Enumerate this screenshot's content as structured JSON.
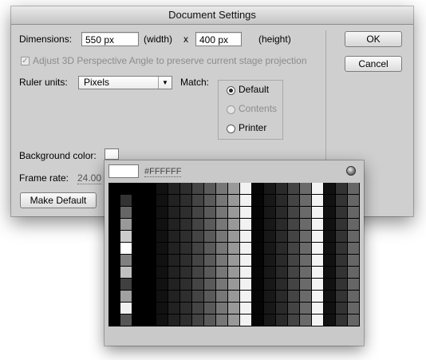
{
  "dialog": {
    "title": "Document Settings",
    "dimensions": {
      "label": "Dimensions:",
      "width_value": "550 px",
      "width_label": "(width)",
      "times": "x",
      "height_value": "400 px",
      "height_label": "(height)"
    },
    "adjust_3d": {
      "label": "Adjust 3D Perspective Angle to preserve current stage projection",
      "checked": true,
      "check_glyph": "✓"
    },
    "ruler_units": {
      "label": "Ruler units:",
      "value": "Pixels",
      "arrow": "▼"
    },
    "match": {
      "label": "Match:",
      "options": [
        "Default",
        "Contents",
        "Printer"
      ],
      "selected": "Default"
    },
    "background_color": {
      "label": "Background color:",
      "value": "#FFFFFF"
    },
    "frame_rate": {
      "label": "Frame rate:",
      "value": "24.00"
    },
    "make_default_label": "Make Default",
    "ok_label": "OK",
    "cancel_label": "Cancel"
  },
  "palette": {
    "hex": "#FFFFFF",
    "no_color_icon": "no-color-icon",
    "first_col": [
      "#000000",
      "#333333",
      "#666666",
      "#999999",
      "#cccccc",
      "#ffffff",
      "#808080",
      "#c0c0c0",
      "#404040",
      "#a0a0a0",
      "#f0f0f0",
      "#555555"
    ],
    "rows": [
      [
        "#000000",
        "#000000",
        "#000000",
        "#000000",
        "#000000",
        "#000000",
        "#000000",
        "#000000",
        "#000000",
        "#000000",
        "#000000",
        "#000000"
      ],
      [
        "#000000",
        "#000000",
        "#000000",
        "#000000",
        "#000000",
        "#000000",
        "#000000",
        "#000000",
        "#000000",
        "#000000",
        "#000000",
        "#000000"
      ],
      [
        "#000000",
        "#000000",
        "#000000",
        "#000000",
        "#000000",
        "#000000",
        "#000000",
        "#000000",
        "#000000",
        "#000000",
        "#000000",
        "#000000"
      ],
      [
        "#111111",
        "#111111",
        "#111111",
        "#111111",
        "#111111",
        "#111111",
        "#111111",
        "#111111",
        "#111111",
        "#111111",
        "#111111",
        "#111111"
      ],
      [
        "#222222",
        "#222222",
        "#222222",
        "#222222",
        "#222222",
        "#222222",
        "#222222",
        "#222222",
        "#222222",
        "#222222",
        "#222222",
        "#222222"
      ],
      [
        "#2e2e2e",
        "#2e2e2e",
        "#2e2e2e",
        "#2e2e2e",
        "#2e2e2e",
        "#2e2e2e",
        "#2e2e2e",
        "#2e2e2e",
        "#2e2e2e",
        "#2e2e2e",
        "#2e2e2e",
        "#2e2e2e"
      ],
      [
        "#444444",
        "#444444",
        "#444444",
        "#444444",
        "#444444",
        "#444444",
        "#444444",
        "#444444",
        "#444444",
        "#444444",
        "#444444",
        "#444444"
      ],
      [
        "#5a5a5a",
        "#5a5a5a",
        "#5a5a5a",
        "#5a5a5a",
        "#5a5a5a",
        "#5a5a5a",
        "#5a5a5a",
        "#5a5a5a",
        "#5a5a5a",
        "#5a5a5a",
        "#5a5a5a",
        "#5a5a5a"
      ],
      [
        "#777777",
        "#777777",
        "#777777",
        "#777777",
        "#777777",
        "#777777",
        "#777777",
        "#777777",
        "#777777",
        "#777777",
        "#777777",
        "#777777"
      ],
      [
        "#999999",
        "#999999",
        "#999999",
        "#999999",
        "#999999",
        "#999999",
        "#999999",
        "#999999",
        "#999999",
        "#999999",
        "#999999",
        "#999999"
      ],
      [
        "#f2f2f2",
        "#f2f2f2",
        "#f2f2f2",
        "#f2f2f2",
        "#f2f2f2",
        "#f2f2f2",
        "#f2f2f2",
        "#f2f2f2",
        "#f2f2f2",
        "#f2f2f2",
        "#f2f2f2",
        "#f2f2f2"
      ],
      [
        "#050505",
        "#050505",
        "#050505",
        "#050505",
        "#050505",
        "#050505",
        "#050505",
        "#050505",
        "#050505",
        "#050505",
        "#050505",
        "#050505"
      ],
      [
        "#181818",
        "#181818",
        "#181818",
        "#181818",
        "#181818",
        "#181818",
        "#181818",
        "#181818",
        "#181818",
        "#181818",
        "#181818",
        "#181818"
      ],
      [
        "#2a2a2a",
        "#2a2a2a",
        "#2a2a2a",
        "#2a2a2a",
        "#2a2a2a",
        "#2a2a2a",
        "#2a2a2a",
        "#2a2a2a",
        "#2a2a2a",
        "#2a2a2a",
        "#2a2a2a",
        "#2a2a2a"
      ],
      [
        "#444444",
        "#444444",
        "#444444",
        "#444444",
        "#444444",
        "#444444",
        "#444444",
        "#444444",
        "#444444",
        "#444444",
        "#444444",
        "#444444"
      ],
      [
        "#6a6a6a",
        "#6a6a6a",
        "#6a6a6a",
        "#6a6a6a",
        "#6a6a6a",
        "#6a6a6a",
        "#6a6a6a",
        "#6a6a6a",
        "#6a6a6a",
        "#6a6a6a",
        "#6a6a6a",
        "#6a6a6a"
      ],
      [
        "#f4f4f4",
        "#f4f4f4",
        "#f4f4f4",
        "#f4f4f4",
        "#f4f4f4",
        "#f4f4f4",
        "#f4f4f4",
        "#f4f4f4",
        "#f4f4f4",
        "#f4f4f4",
        "#f4f4f4",
        "#f4f4f4"
      ],
      [
        "#111111",
        "#111111",
        "#111111",
        "#111111",
        "#111111",
        "#111111",
        "#111111",
        "#111111",
        "#111111",
        "#111111",
        "#111111",
        "#111111"
      ],
      [
        "#333333",
        "#333333",
        "#333333",
        "#333333",
        "#333333",
        "#333333",
        "#333333",
        "#333333",
        "#333333",
        "#333333",
        "#333333",
        "#333333"
      ],
      [
        "#666666",
        "#666666",
        "#666666",
        "#666666",
        "#666666",
        "#666666",
        "#666666",
        "#666666",
        "#666666",
        "#666666",
        "#666666",
        "#666666"
      ],
      [
        "#aaaaaa",
        "#aaaaaa",
        "#aaaaaa",
        "#aaaaaa",
        "#aaaaaa",
        "#aaaaaa",
        "#aaaaaa",
        "#aaaaaa",
        "#aaaaaa",
        "#aaaaaa",
        "#aaaaaa",
        "#aaaaaa"
      ],
      [
        "#e8e8e8",
        "#e8e8e8",
        "#e8e8e8",
        "#e8e8e8",
        "#e8e8e8",
        "#e8e8e8",
        "#e8e8e8",
        "#e8e8e8",
        "#e8e8e8",
        "#e8e8e8",
        "#e8e8e8",
        "#e8e8e8"
      ]
    ]
  }
}
